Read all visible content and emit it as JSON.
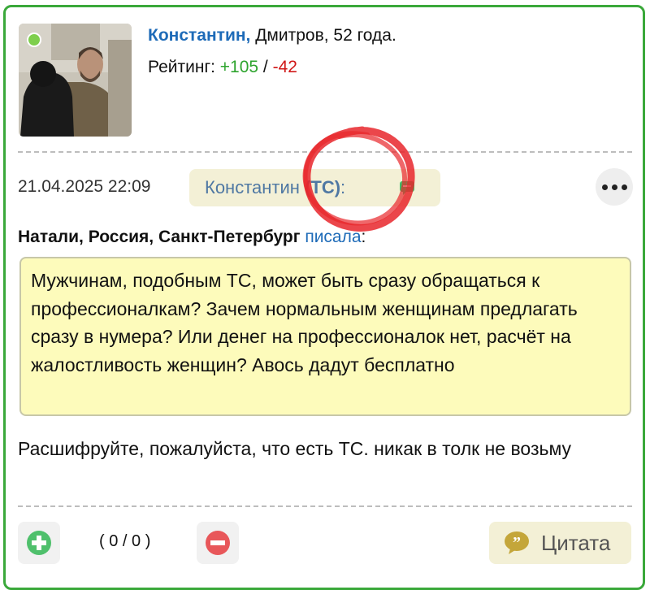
{
  "profile": {
    "name": "Константин,",
    "details": " Дмитров, 52 года.",
    "rating_label": "Рейтинг: ",
    "rating_plus": "+105",
    "rating_sep": " / ",
    "rating_minus": "-42",
    "online_color": "#7ecf4d"
  },
  "post": {
    "timestamp": "21.04.2025 22:09",
    "reply_to_name": "Константин",
    "reply_to_tag": "(ТС)",
    "reply_to_suffix": ":",
    "more_icon": "ellipsis-icon"
  },
  "quote": {
    "author": "Натали, Россия, Санкт-Петербург",
    "link": "писала",
    "colon": ":",
    "text": "Мужчинам, подобным ТС, может быть сразу обращаться к профессионалкам? Зачем нормальным женщинам предлагать сразу в нумера? Или денег на профессионалок нет, расчёт на жалостливость женщин? Авось дадут бесплатно"
  },
  "body": {
    "text": "Расшифруйте, пожалуйста, что есть ТС. никак в толк не возьму"
  },
  "footer": {
    "vote_count": "( 0 / 0 )",
    "quote_label": "Цитата",
    "upvote_icon": "plus-icon",
    "downvote_icon": "minus-icon",
    "quote_icon": "quote-icon"
  },
  "colors": {
    "border": "#3aa83a",
    "link": "#1e6bb8",
    "plus": "#2ea42e",
    "minus": "#d01818",
    "quote_bg": "#fdfbbb",
    "annotation": "#e8262b"
  }
}
